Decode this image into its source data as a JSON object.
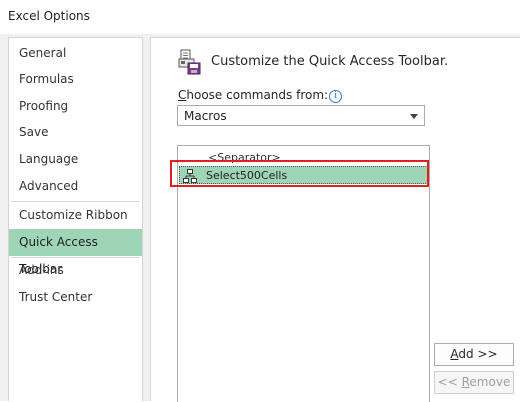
{
  "window": {
    "title": "Excel Options"
  },
  "sidebar": {
    "items": [
      {
        "label": "General"
      },
      {
        "label": "Formulas"
      },
      {
        "label": "Proofing"
      },
      {
        "label": "Save"
      },
      {
        "label": "Language"
      },
      {
        "label": "Advanced"
      },
      {
        "label": "Customize Ribbon"
      },
      {
        "label": "Quick Access Toolbar",
        "selected": true
      },
      {
        "label": "Add-ins"
      },
      {
        "label": "Trust Center"
      }
    ]
  },
  "main": {
    "heading": "Customize the Quick Access Toolbar.",
    "choose_label_first": "C",
    "choose_label_rest": "hoose commands from:",
    "dropdown_value": "Macros",
    "list": [
      {
        "label": "<Separator>"
      },
      {
        "label": "Select500Cells",
        "selected": true
      }
    ],
    "add_button_underlined": "A",
    "add_button_rest": "dd >>",
    "remove_button_prefix": "<< ",
    "remove_button_underlined": "R",
    "remove_button_rest": "emove"
  },
  "colors": {
    "selection": "#9fd5b7",
    "highlight_border": "#e02020",
    "info_icon": "#2b79d6"
  },
  "icons": {
    "toolbar": "quick-access-toolbar-icon",
    "macro": "macro-icon",
    "info": "info-icon",
    "dropdown": "chevron-down-icon"
  }
}
